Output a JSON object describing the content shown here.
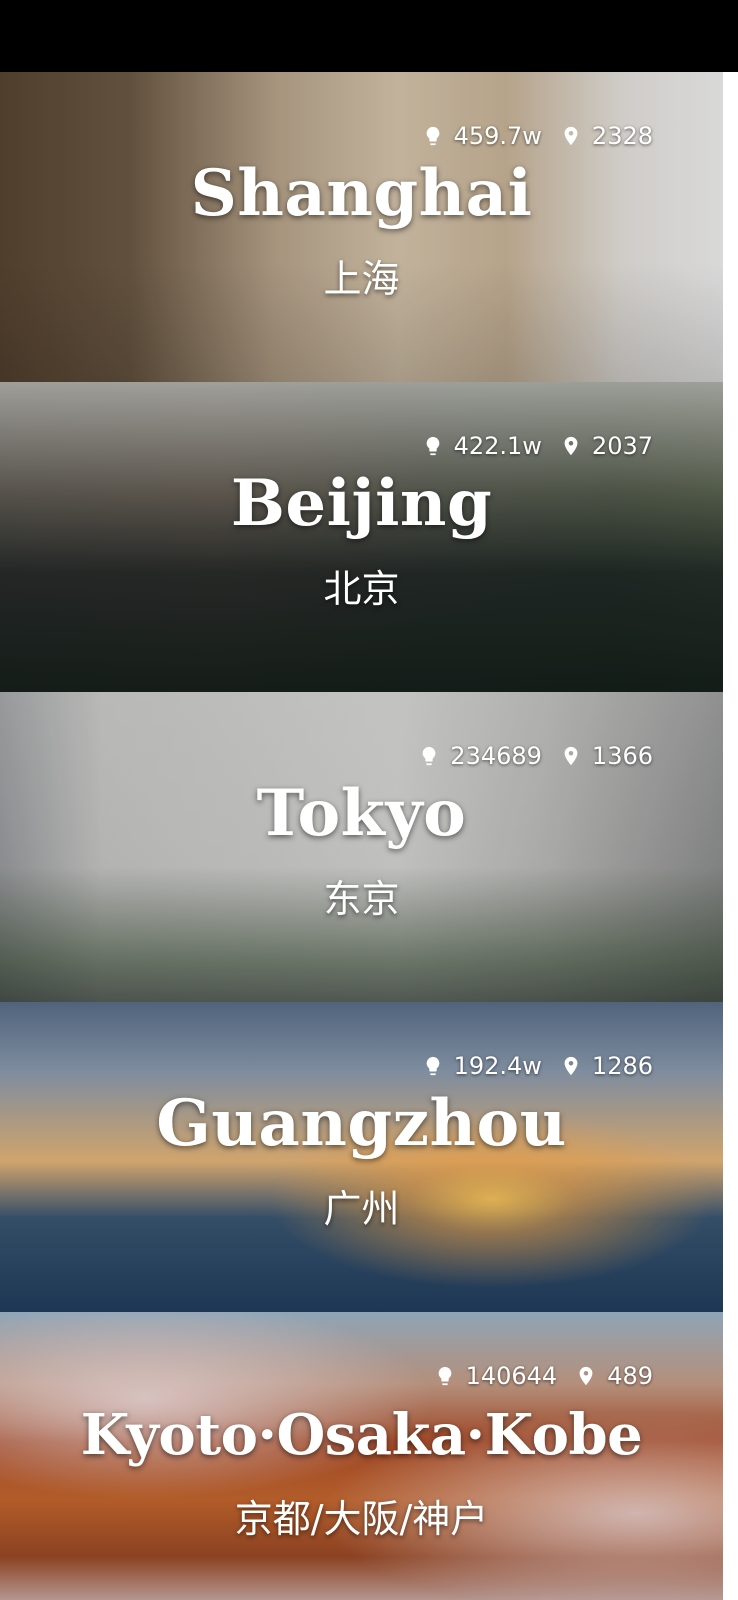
{
  "cities": [
    {
      "name": "Shanghai",
      "local_name": "上海",
      "stat_one": "459.7w",
      "stat_two": "2328",
      "stat_one_icon": "bulb-icon",
      "stat_two_icon": "location-pin-icon"
    },
    {
      "name": "Beijing",
      "local_name": "北京",
      "stat_one": "422.1w",
      "stat_two": "2037",
      "stat_one_icon": "bulb-icon",
      "stat_two_icon": "location-pin-icon"
    },
    {
      "name": "Tokyo",
      "local_name": "东京",
      "stat_one": "234689",
      "stat_two": "1366",
      "stat_one_icon": "bulb-icon",
      "stat_two_icon": "location-pin-icon"
    },
    {
      "name": "Guangzhou",
      "local_name": "广州",
      "stat_one": "192.4w",
      "stat_two": "1286",
      "stat_one_icon": "bulb-icon",
      "stat_two_icon": "location-pin-icon"
    },
    {
      "name": "Kyoto·Osaka·Kobe",
      "local_name": "京都/大阪/神户",
      "stat_one": "140644",
      "stat_two": "489",
      "stat_one_icon": "bulb-icon",
      "stat_two_icon": "location-pin-icon"
    }
  ]
}
